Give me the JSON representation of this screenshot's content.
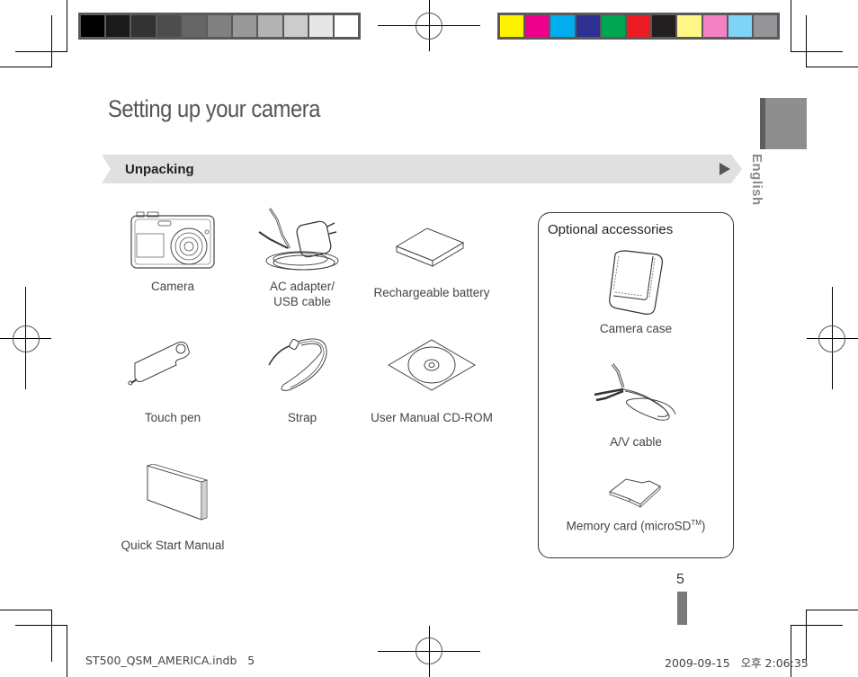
{
  "print_marks": {
    "grayscale_swatches": [
      "#000000",
      "#1a1a1a",
      "#333333",
      "#4d4d4d",
      "#666666",
      "#808080",
      "#999999",
      "#b3b3b3",
      "#cccccc",
      "#e6e6e6",
      "#ffffff"
    ],
    "color_swatches": [
      "#fff200",
      "#ec008c",
      "#00aeef",
      "#2e3192",
      "#00a651",
      "#ed1c24",
      "#231f20",
      "#fff685",
      "#f583c4",
      "#7fd3f7",
      "#939598"
    ]
  },
  "page": {
    "title": "Setting up your camera",
    "section": "Unpacking",
    "language_tab": "English",
    "page_number": "5"
  },
  "package_items": [
    {
      "label": "Camera",
      "icon": "camera-icon"
    },
    {
      "label": "AC adapter/\nUSB cable",
      "label_line1": "AC adapter/",
      "label_line2": "USB cable",
      "icon": "ac-adapter-icon"
    },
    {
      "label": "Rechargeable battery",
      "icon": "battery-icon"
    },
    {
      "label": "Touch pen",
      "icon": "touch-pen-icon"
    },
    {
      "label": "Strap",
      "icon": "strap-icon"
    },
    {
      "label": "User Manual CD-ROM",
      "icon": "cd-rom-icon"
    },
    {
      "label": "Quick Start Manual",
      "icon": "manual-icon"
    }
  ],
  "optional_accessories": {
    "title": "Optional accessories",
    "items": [
      {
        "label": "Camera case",
        "icon": "camera-case-icon"
      },
      {
        "label": "A/V cable",
        "icon": "av-cable-icon"
      },
      {
        "label": "Memory card (microSD",
        "superscript": "TM",
        "suffix": ")",
        "icon": "memory-card-icon"
      }
    ]
  },
  "footer": {
    "file": "ST500_QSM_AMERICA.indb   5",
    "timestamp": "2009-09-15   오후 2:06:35"
  }
}
